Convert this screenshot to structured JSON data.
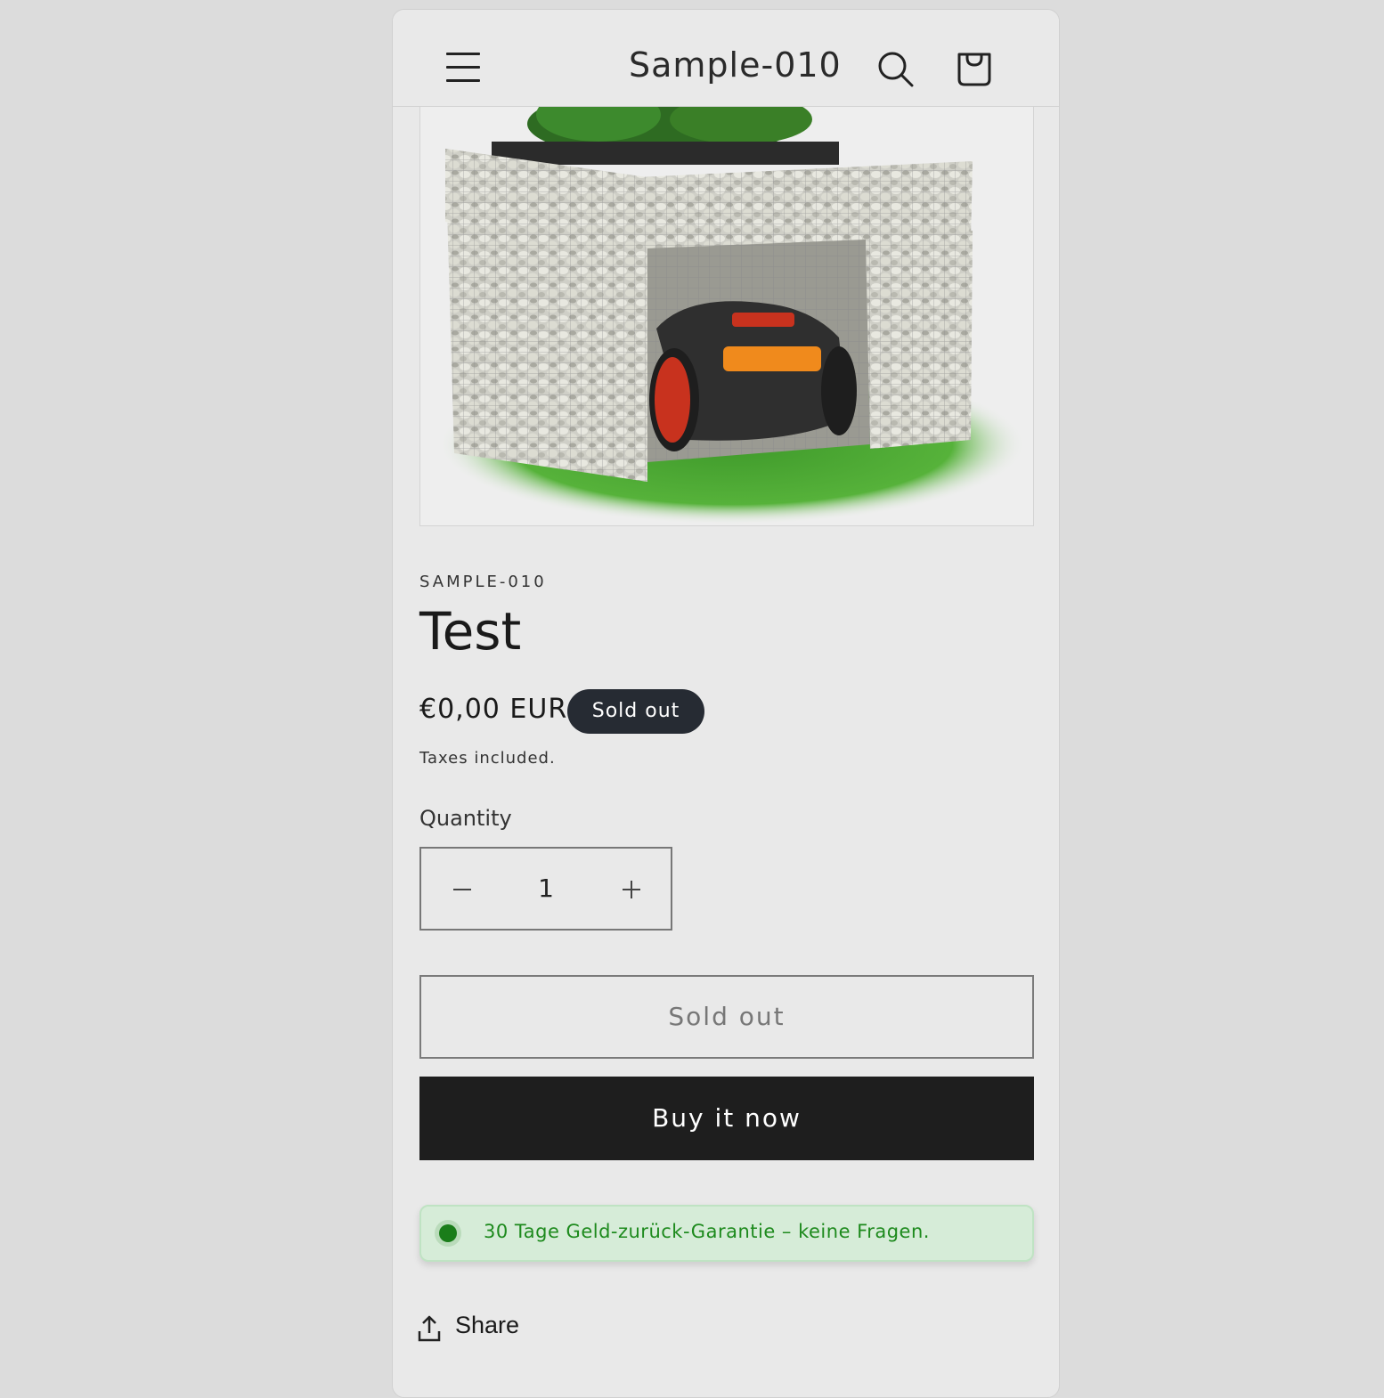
{
  "header": {
    "store_name": "Sample-010",
    "menu_icon": "hamburger-menu-icon",
    "search_icon": "search-icon",
    "cart_icon": "shopping-bag-icon"
  },
  "product": {
    "image_description": "gabion-mower-garage-image",
    "vendor": "SAMPLE-010",
    "title": "Test",
    "price": "€0,00 EUR",
    "badge": "Sold out",
    "tax_note": "Taxes included."
  },
  "quantity": {
    "label": "Quantity",
    "value": "1"
  },
  "buttons": {
    "sold_out": "Sold out",
    "buy_now": "Buy it now"
  },
  "guarantee": {
    "text": "30 Tage Geld-zurück-Garantie – keine Fragen.",
    "color": "#1d8a1d"
  },
  "share": {
    "label": "Share",
    "icon": "share-upload-icon"
  },
  "colors": {
    "badge_bg": "#262b33",
    "buy_bg": "#1e1e1e",
    "page_bg": "#e9e9e9"
  }
}
